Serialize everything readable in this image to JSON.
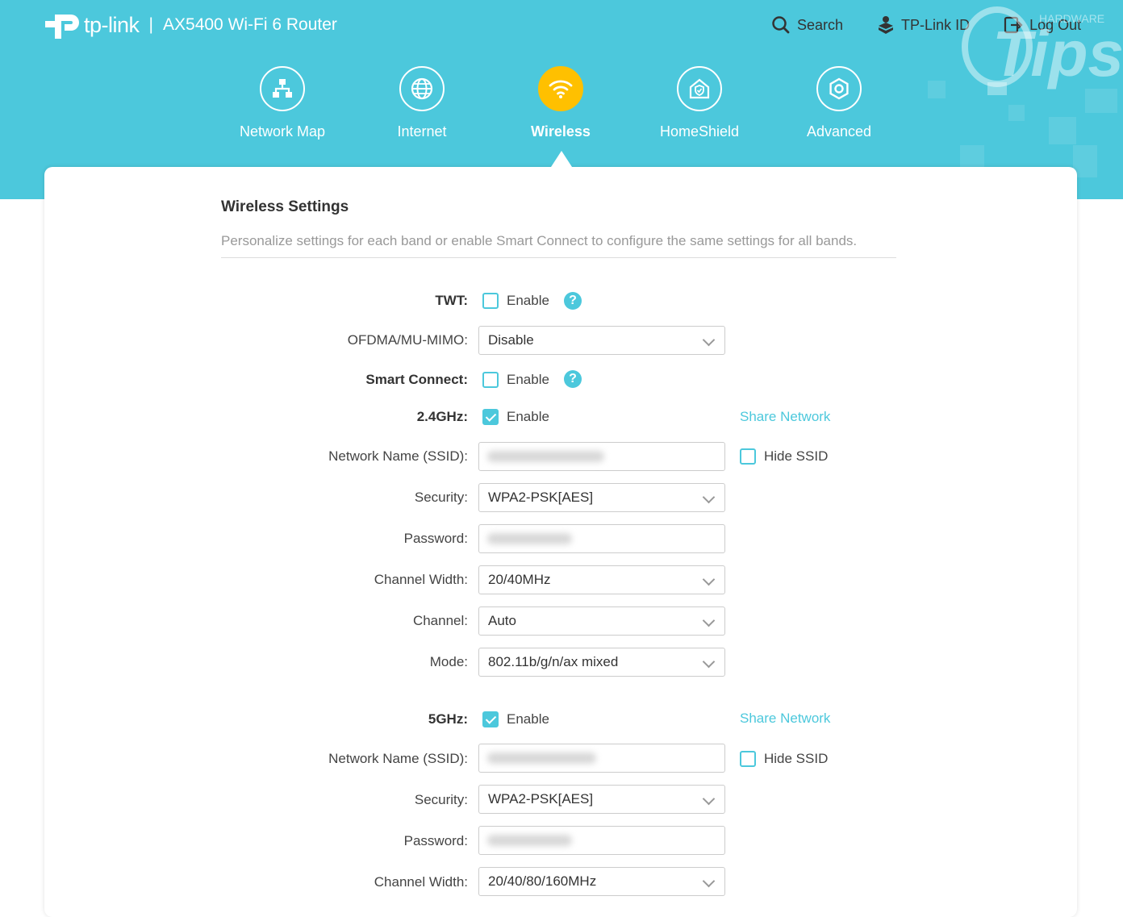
{
  "brand": {
    "name": "tp-link",
    "separator": "|",
    "model": "AX5400 Wi-Fi 6 Router"
  },
  "top_links": {
    "search": "Search",
    "tplink_id": "TP-Link ID",
    "logout": "Log Out"
  },
  "watermark": {
    "text": "Tips",
    "sub": "HARDWARE"
  },
  "nav": [
    {
      "label": "Network Map",
      "icon": "network-map-icon"
    },
    {
      "label": "Internet",
      "icon": "globe-icon"
    },
    {
      "label": "Wireless",
      "icon": "wifi-icon",
      "active": true
    },
    {
      "label": "HomeShield",
      "icon": "home-shield-icon"
    },
    {
      "label": "Advanced",
      "icon": "gear-icon"
    }
  ],
  "settings": {
    "title": "Wireless Settings",
    "description": "Personalize settings for each band or enable Smart Connect to configure the same settings for all bands.",
    "twt": {
      "label": "TWT:",
      "enable": "Enable",
      "checked": false
    },
    "ofdma": {
      "label": "OFDMA/MU-MIMO:",
      "value": "Disable"
    },
    "smart_connect": {
      "label": "Smart Connect:",
      "enable": "Enable",
      "checked": false
    },
    "band24": {
      "label": "2.4GHz:",
      "enable": "Enable",
      "checked": true,
      "share": "Share Network",
      "ssid_label": "Network Name (SSID):",
      "hide_ssid": "Hide SSID",
      "hide_checked": false,
      "security_label": "Security:",
      "security": "WPA2-PSK[AES]",
      "password_label": "Password:",
      "width_label": "Channel Width:",
      "width": "20/40MHz",
      "channel_label": "Channel:",
      "channel": "Auto",
      "mode_label": "Mode:",
      "mode": "802.11b/g/n/ax mixed"
    },
    "band5": {
      "label": "5GHz:",
      "enable": "Enable",
      "checked": true,
      "share": "Share Network",
      "ssid_label": "Network Name (SSID):",
      "hide_ssid": "Hide SSID",
      "hide_checked": false,
      "security_label": "Security:",
      "security": "WPA2-PSK[AES]",
      "password_label": "Password:",
      "width_label": "Channel Width:",
      "width": "20/40/80/160MHz"
    }
  },
  "colors": {
    "accent": "#4cc8dc",
    "active_nav": "#ffc000"
  }
}
